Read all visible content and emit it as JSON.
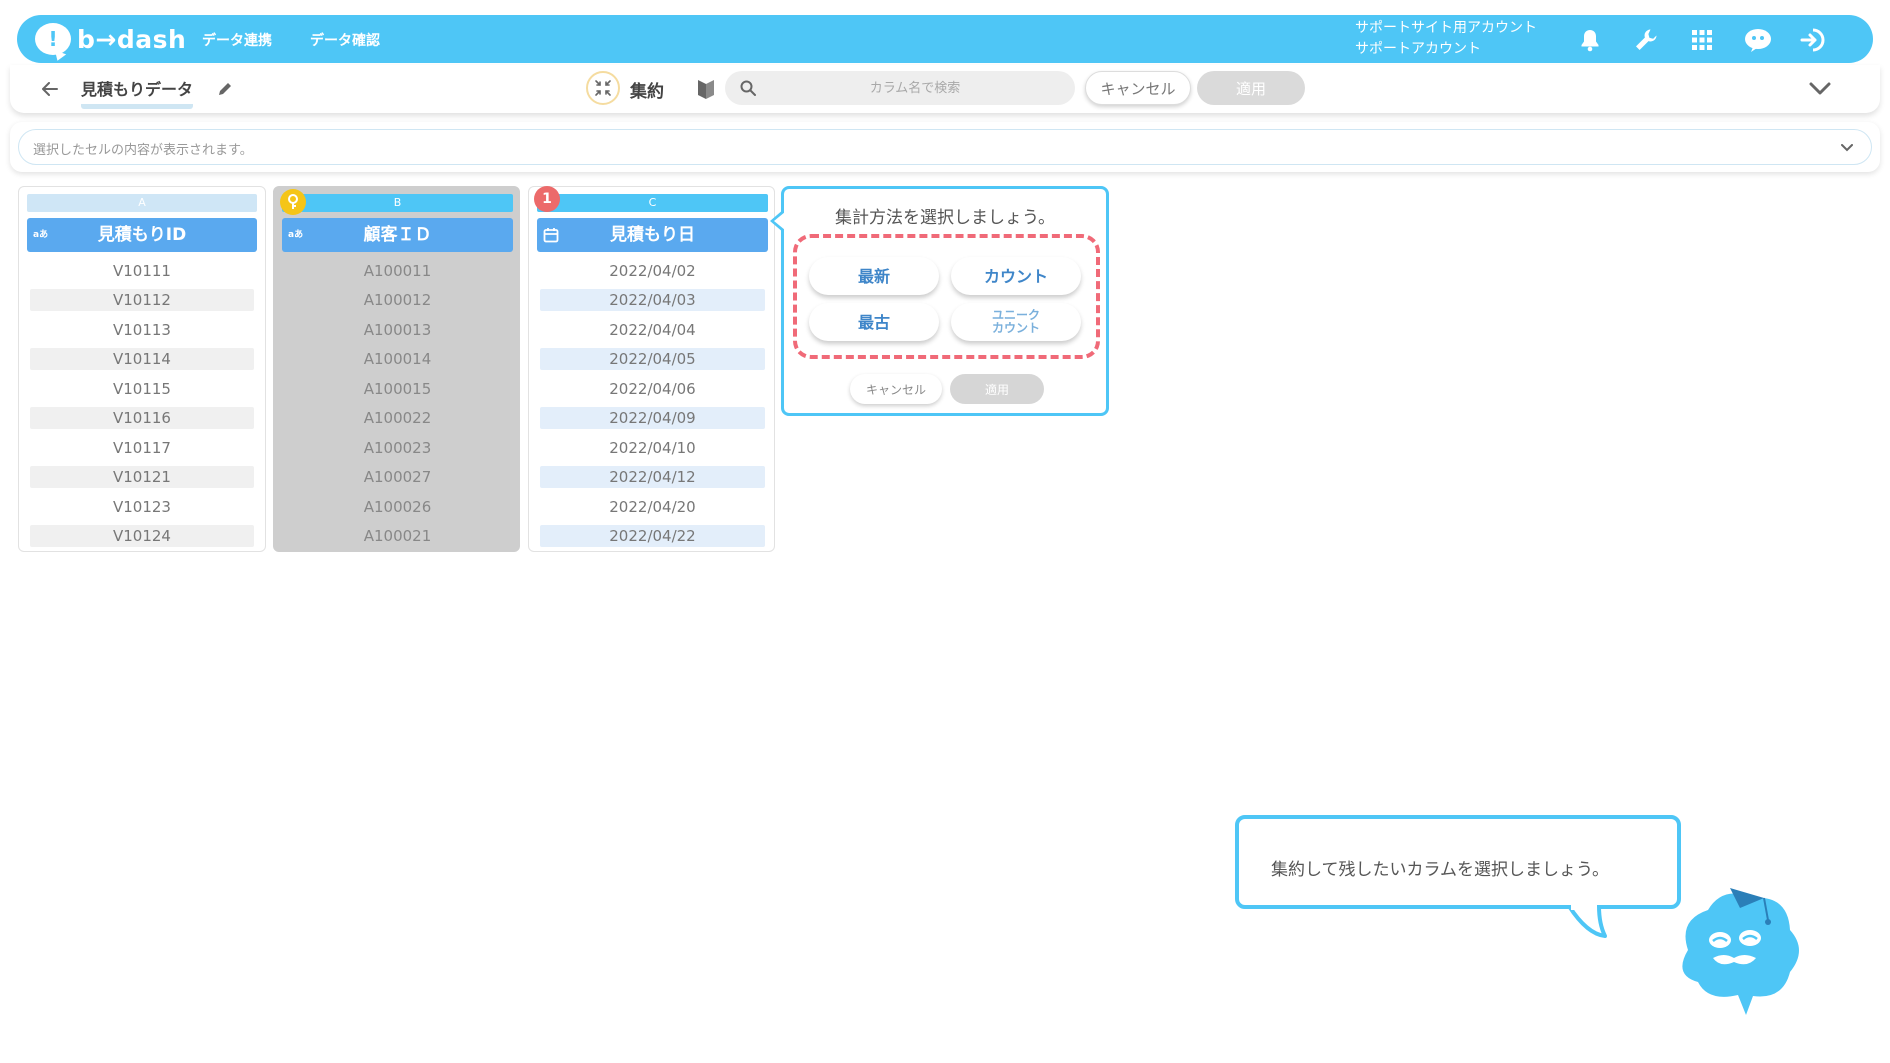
{
  "header": {
    "logo_mark": "!",
    "logo_text": "b→dash",
    "nav": [
      {
        "label": "データ連携"
      },
      {
        "label": "データ確認"
      }
    ],
    "account_line1": "サポートサイト用アカウント",
    "account_line2": "サポートアカウント",
    "icons": [
      "bell-icon",
      "wrench-icon",
      "apps-grid-icon",
      "chat-mascot-icon",
      "logout-icon"
    ],
    "accent_color": "#4ec6f6"
  },
  "toolbar": {
    "page_title": "見積もりデータ",
    "mode_label": "集約",
    "search_placeholder": "カラム名で検索",
    "cancel_label": "キャンセル",
    "apply_label": "適用"
  },
  "cell_bar": {
    "placeholder": "選択したセルの内容が表示されます。"
  },
  "columns": [
    {
      "letter": "A",
      "header": "見積もりID",
      "type_badge": "aあ",
      "cells": [
        "V10111",
        "V10112",
        "V10113",
        "V10114",
        "V10115",
        "V10116",
        "V10117",
        "V10121",
        "V10123",
        "V10124"
      ]
    },
    {
      "letter": "B",
      "header": "顧客ＩＤ",
      "type_badge": "aあ",
      "key_badge_color": "#f5c518",
      "cells": [
        "A100011",
        "A100012",
        "A100013",
        "A100014",
        "A100015",
        "A100022",
        "A100023",
        "A100027",
        "A100026",
        "A100021"
      ]
    },
    {
      "letter": "C",
      "header": "見積もり日",
      "number_badge": "1",
      "number_badge_color": "#ec6a6a",
      "cells": [
        "2022/04/02",
        "2022/04/03",
        "2022/04/04",
        "2022/04/05",
        "2022/04/06",
        "2022/04/09",
        "2022/04/10",
        "2022/04/12",
        "2022/04/20",
        "2022/04/22"
      ]
    }
  ],
  "popup": {
    "title": "集計方法を選択しましょう。",
    "methods": {
      "latest": "最新",
      "count": "カウント",
      "oldest": "最古",
      "unique_line1": "ユニーク",
      "unique_line2": "カウント"
    },
    "cancel_label": "キャンセル",
    "apply_label": "適用",
    "highlight_color": "#f06a78"
  },
  "tooltip": {
    "text": "集約して残したいカラムを選択しましょう。"
  }
}
